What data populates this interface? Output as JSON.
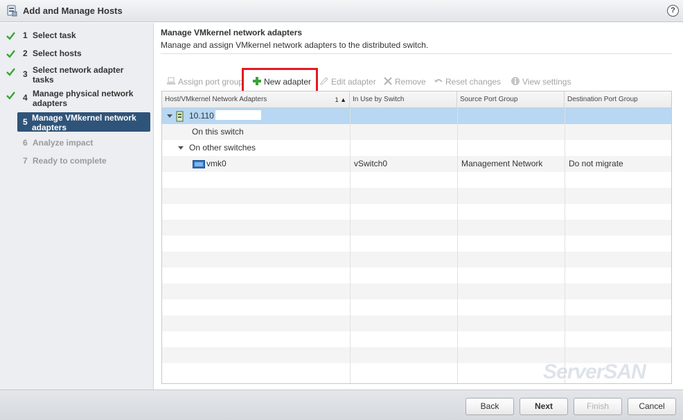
{
  "window": {
    "title": "Add and Manage Hosts",
    "help_glyph": "?"
  },
  "steps": [
    {
      "num": "1",
      "label": "Select task",
      "state": "done"
    },
    {
      "num": "2",
      "label": "Select hosts",
      "state": "done"
    },
    {
      "num": "3",
      "label": "Select network adapter tasks",
      "state": "done"
    },
    {
      "num": "4",
      "label": "Manage physical network adapters",
      "state": "done"
    },
    {
      "num": "5",
      "label": "Manage VMkernel network adapters",
      "state": "active"
    },
    {
      "num": "6",
      "label": "Analyze impact",
      "state": "disabled"
    },
    {
      "num": "7",
      "label": "Ready to complete",
      "state": "disabled"
    }
  ],
  "page": {
    "title": "Manage VMkernel network adapters",
    "description": "Manage and assign VMkernel network adapters to the distributed switch."
  },
  "toolbar": {
    "assign": "Assign port group",
    "new_adapter": "New adapter",
    "edit": "Edit adapter",
    "remove": "Remove",
    "reset": "Reset changes",
    "view": "View settings"
  },
  "table": {
    "columns": [
      "Host/VMkernel Network Adapters",
      "In Use by Switch",
      "Source Port Group",
      "Destination Port Group"
    ],
    "sort_indicator": "1 ▲",
    "host": "10.110",
    "group_this": "On this switch",
    "group_other": "On other switches",
    "adapter": {
      "name": "vmk0",
      "switch": "vSwitch0",
      "source": "Management Network",
      "destination": "Do not migrate"
    }
  },
  "footer": {
    "back": "Back",
    "next": "Next",
    "finish": "Finish",
    "cancel": "Cancel"
  },
  "watermark": "ServerSAN",
  "colors": {
    "active_step": "#2f5479",
    "selected_row": "#b7d7f2",
    "check": "#3aa335",
    "highlight": "#e21a22"
  }
}
